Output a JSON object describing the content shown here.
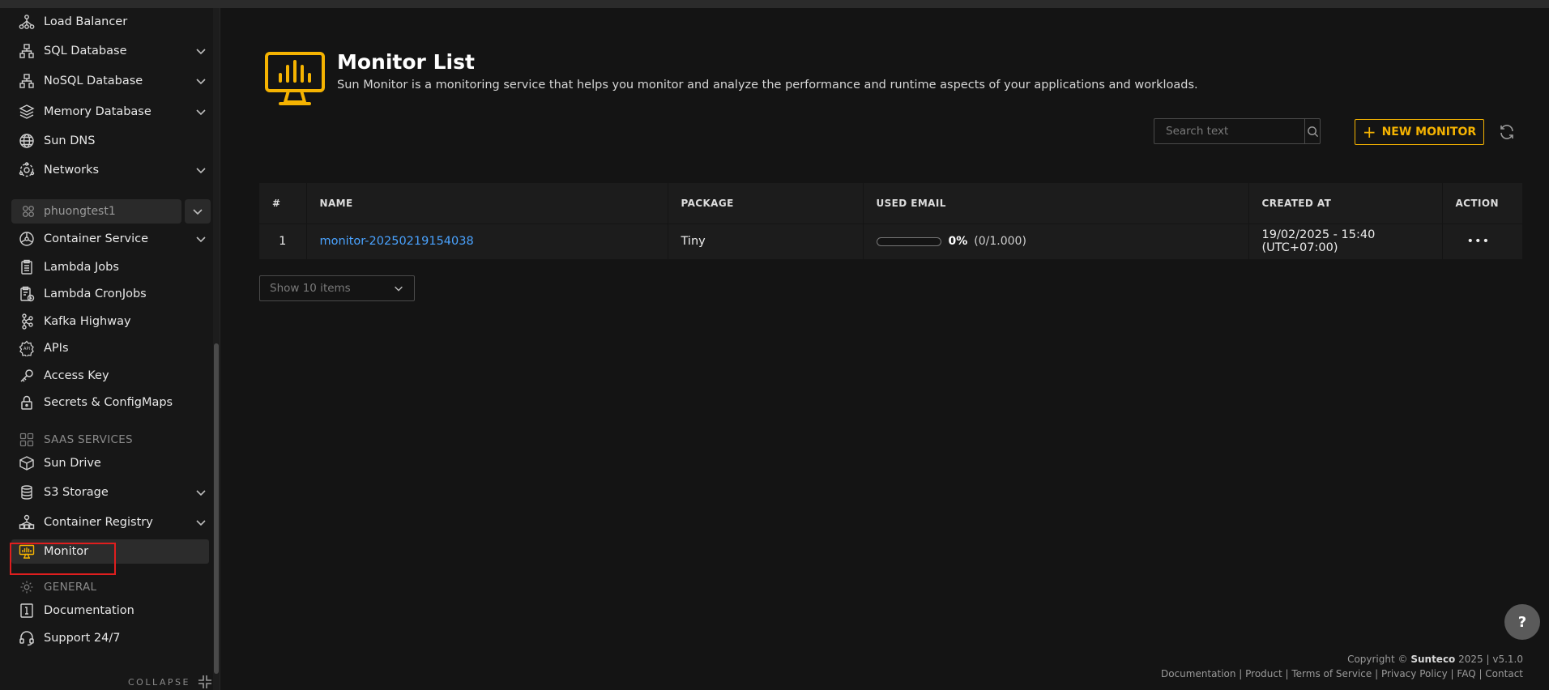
{
  "sidebar": {
    "items_top": [
      {
        "label": "Load Balancer",
        "icon": "load-balancer-icon",
        "has_children": false
      },
      {
        "label": "SQL Database",
        "icon": "sql-database-icon",
        "has_children": true
      },
      {
        "label": "NoSQL Database",
        "icon": "nosql-database-icon",
        "has_children": true
      },
      {
        "label": "Memory Database",
        "icon": "memory-database-icon",
        "has_children": true
      },
      {
        "label": "Sun DNS",
        "icon": "globe-icon",
        "has_children": false
      },
      {
        "label": "Networks",
        "icon": "network-icon",
        "has_children": true
      }
    ],
    "project": "phuongtest1",
    "items_project": [
      {
        "label": "Container Service",
        "has_children": true
      },
      {
        "label": "Lambda Jobs",
        "has_children": false
      },
      {
        "label": "Lambda CronJobs",
        "has_children": false
      },
      {
        "label": "Kafka Highway",
        "has_children": false
      },
      {
        "label": "APIs",
        "has_children": false
      },
      {
        "label": "Access Key",
        "has_children": false
      },
      {
        "label": "Secrets & ConfigMaps",
        "has_children": false
      }
    ],
    "saas_section": "SAAS SERVICES",
    "items_saas": [
      {
        "label": "Sun Drive",
        "has_children": false
      },
      {
        "label": "S3 Storage",
        "has_children": true
      },
      {
        "label": "Container Registry",
        "has_children": true
      },
      {
        "label": "Monitor",
        "has_children": false,
        "active": true
      }
    ],
    "general_section": "GENERAL",
    "items_general": [
      {
        "label": "Documentation"
      },
      {
        "label": "Support 24/7"
      }
    ],
    "collapse_label": "COLLAPSE"
  },
  "header": {
    "title": "Monitor List",
    "description": "Sun Monitor is a monitoring service that helps you monitor and analyze the performance and runtime aspects of your applications and workloads."
  },
  "toolbar": {
    "search_placeholder": "Search text",
    "new_button": "NEW MONITOR"
  },
  "table": {
    "columns": [
      "#",
      "NAME",
      "PACKAGE",
      "USED EMAIL",
      "CREATED AT",
      "ACTION"
    ],
    "rows": [
      {
        "index": "1",
        "name": "monitor-20250219154038",
        "package": "Tiny",
        "used_fraction": 0,
        "used_percent": "0%",
        "used_count": "(0/1.000)",
        "created_at": "19/02/2025 - 15:40 (UTC+07:00)",
        "action": "•••"
      }
    ]
  },
  "pager": {
    "selected": "Show 10 items"
  },
  "help": {
    "label": "?"
  },
  "footer": {
    "copyright_prefix": "Copyright ©",
    "copyright_brand": "Sunteco",
    "copyright_suffix": "2025 | v5.1.0",
    "links": "Documentation | Product | Terms of Service | Privacy Policy | FAQ | Contact"
  },
  "colors": {
    "accent": "#f5b301",
    "link": "#4aa3ff",
    "highlight": "#e01e1e"
  }
}
